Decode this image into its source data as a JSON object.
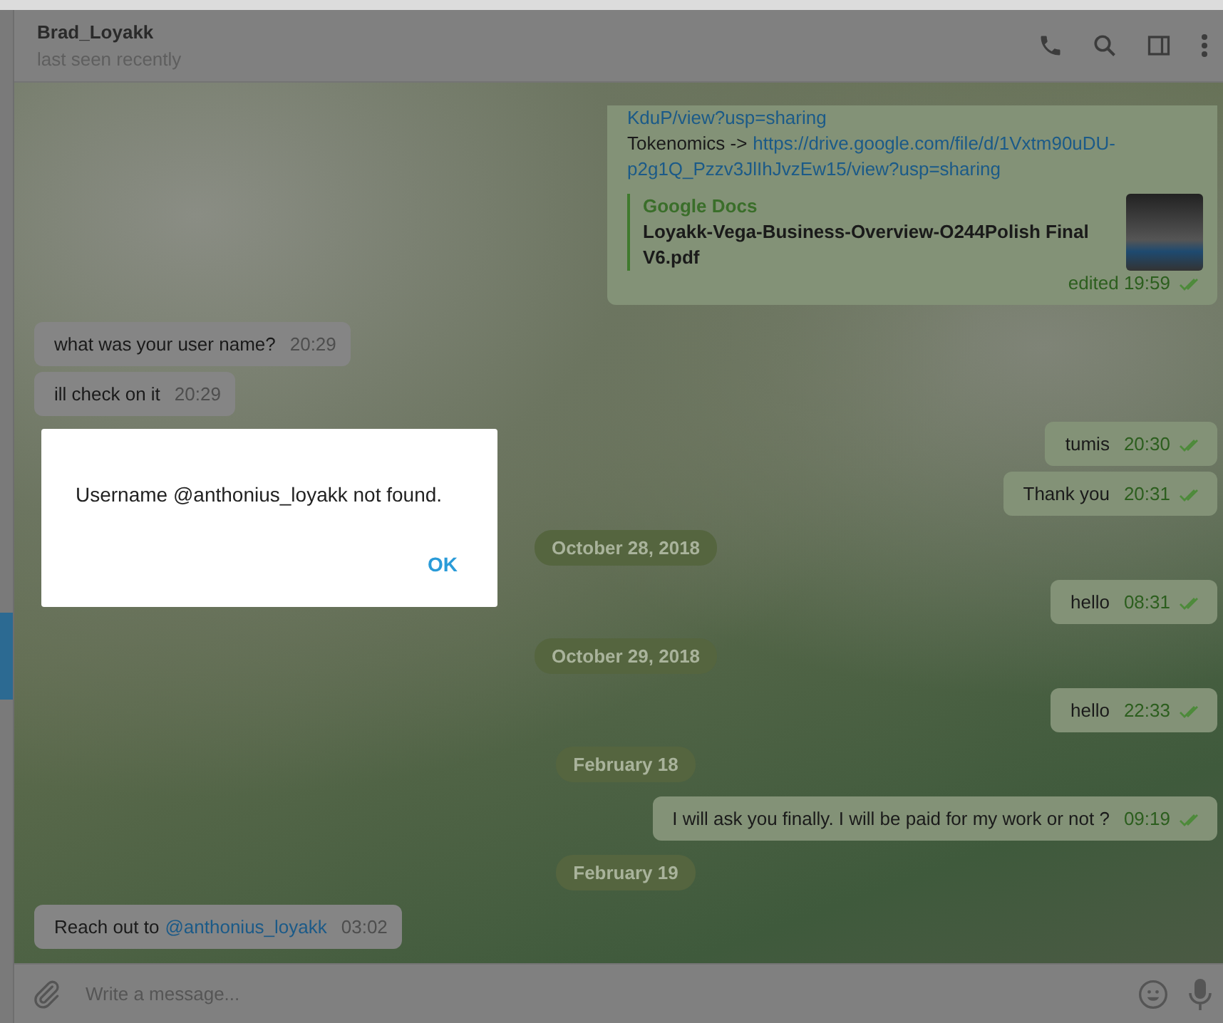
{
  "chat_header": {
    "name": "Brad_Loyakk",
    "status": "last seen recently"
  },
  "messages": [
    {
      "kind": "out",
      "lines": [
        [
          {
            "text": "KduP/view?usp=sharing",
            "link": true
          }
        ],
        [
          {
            "text": "Tokenomics -> ",
            "link": false
          },
          {
            "text": "https://drive.google.com/file/d/1Vxtm90uDU-",
            "link": true
          }
        ],
        [
          {
            "text": "p2g1Q_Pzzv3JlIhJvzEw15/view?usp=sharing",
            "link": true
          }
        ]
      ],
      "preview": {
        "site": "Google Docs",
        "title": "Loyakk-Vega-Business-Overview-O244Polish Final V6.pdf"
      },
      "time": "edited 19:59",
      "read": true
    },
    {
      "kind": "in",
      "lines": [
        [
          {
            "text": "what was your user name?",
            "link": false
          }
        ]
      ],
      "time": "20:29"
    },
    {
      "kind": "in",
      "lines": [
        [
          {
            "text": "ill check on it",
            "link": false
          }
        ]
      ],
      "time": "20:29"
    },
    {
      "kind": "out",
      "lines": [
        [
          {
            "text": "tumis",
            "link": false
          }
        ]
      ],
      "time": "20:30",
      "read": true
    },
    {
      "kind": "out",
      "lines": [
        [
          {
            "text": "Thank you",
            "link": false
          }
        ]
      ],
      "time": "20:31",
      "read": true
    },
    {
      "kind": "date",
      "text": "October 28, 2018"
    },
    {
      "kind": "out",
      "lines": [
        [
          {
            "text": "hello",
            "link": false
          }
        ]
      ],
      "time": "08:31",
      "read": true
    },
    {
      "kind": "date",
      "text": "October 29, 2018"
    },
    {
      "kind": "out",
      "lines": [
        [
          {
            "text": "hello",
            "link": false
          }
        ]
      ],
      "time": "22:33",
      "read": true
    },
    {
      "kind": "date",
      "text": "February 18"
    },
    {
      "kind": "out",
      "lines": [
        [
          {
            "text": "I will ask you finally. I will be paid for my work or not ?",
            "link": false
          }
        ]
      ],
      "time": "09:19",
      "read": true
    },
    {
      "kind": "date",
      "text": "February 19"
    },
    {
      "kind": "in",
      "lines": [
        [
          {
            "text": "Reach out to",
            "link": false
          },
          {
            "text": "@anthonius_loyakk",
            "link": true
          }
        ]
      ],
      "time": "03:02"
    }
  ],
  "composer": {
    "placeholder": "Write a message..."
  },
  "dialog": {
    "message": "Username @anthonius_loyakk not found.",
    "button": "OK"
  }
}
